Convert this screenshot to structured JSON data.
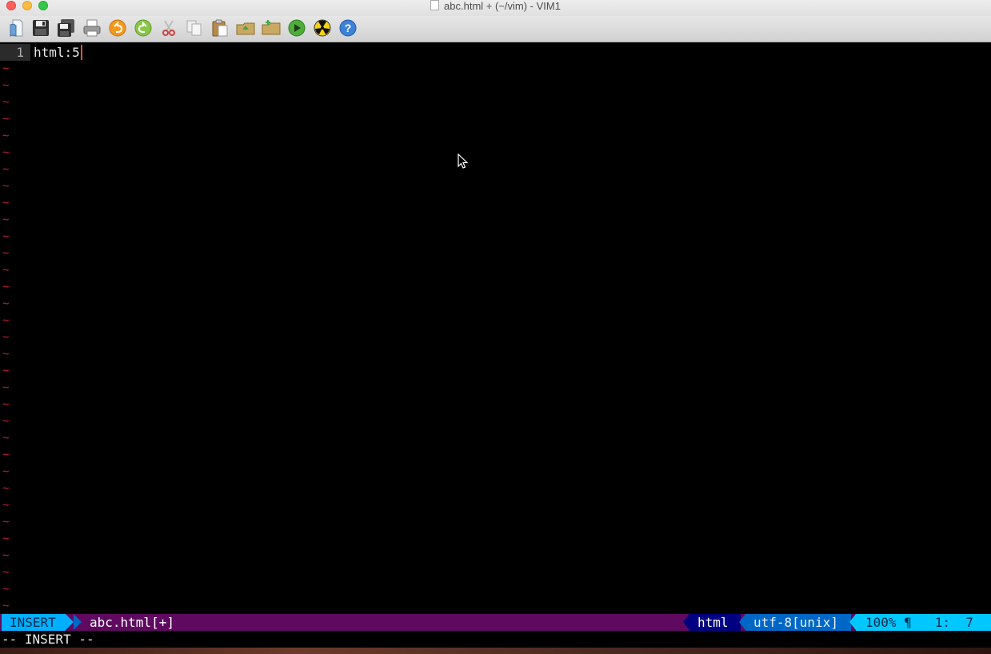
{
  "window": {
    "title": "abc.html + (~/vim) - VIM1"
  },
  "toolbar": {
    "buttons": [
      {
        "name": "open-icon"
      },
      {
        "name": "save-icon"
      },
      {
        "name": "save-all-icon"
      },
      {
        "name": "print-icon"
      },
      {
        "name": "undo-icon"
      },
      {
        "name": "redo-icon"
      },
      {
        "name": "cut-icon"
      },
      {
        "name": "copy-icon"
      },
      {
        "name": "paste-icon"
      },
      {
        "name": "load-session-icon"
      },
      {
        "name": "save-session-icon"
      },
      {
        "name": "run-icon"
      },
      {
        "name": "radioactive-icon"
      },
      {
        "name": "help-icon"
      }
    ]
  },
  "editor": {
    "line_number": "1",
    "line_text": "html:5",
    "empty_marker": "~",
    "empty_line_count": 33
  },
  "statusline": {
    "mode": "INSERT",
    "filename": "abc.html[+]",
    "filetype": "html",
    "encoding": "utf-8[unix]",
    "percent": "100%",
    "eol_glyph": "¶",
    "line": "1:",
    "column": "7"
  },
  "cmdline": {
    "text": "-- INSERT --"
  },
  "colors": {
    "mode_bg": "#00afff",
    "statusline_bg": "#5f0a60",
    "filetype_bg": "#000080",
    "encoding_bg": "#0067c6",
    "position_bg": "#00c8ff",
    "tilde": "#c0222b",
    "cursor": "#e4542e"
  }
}
